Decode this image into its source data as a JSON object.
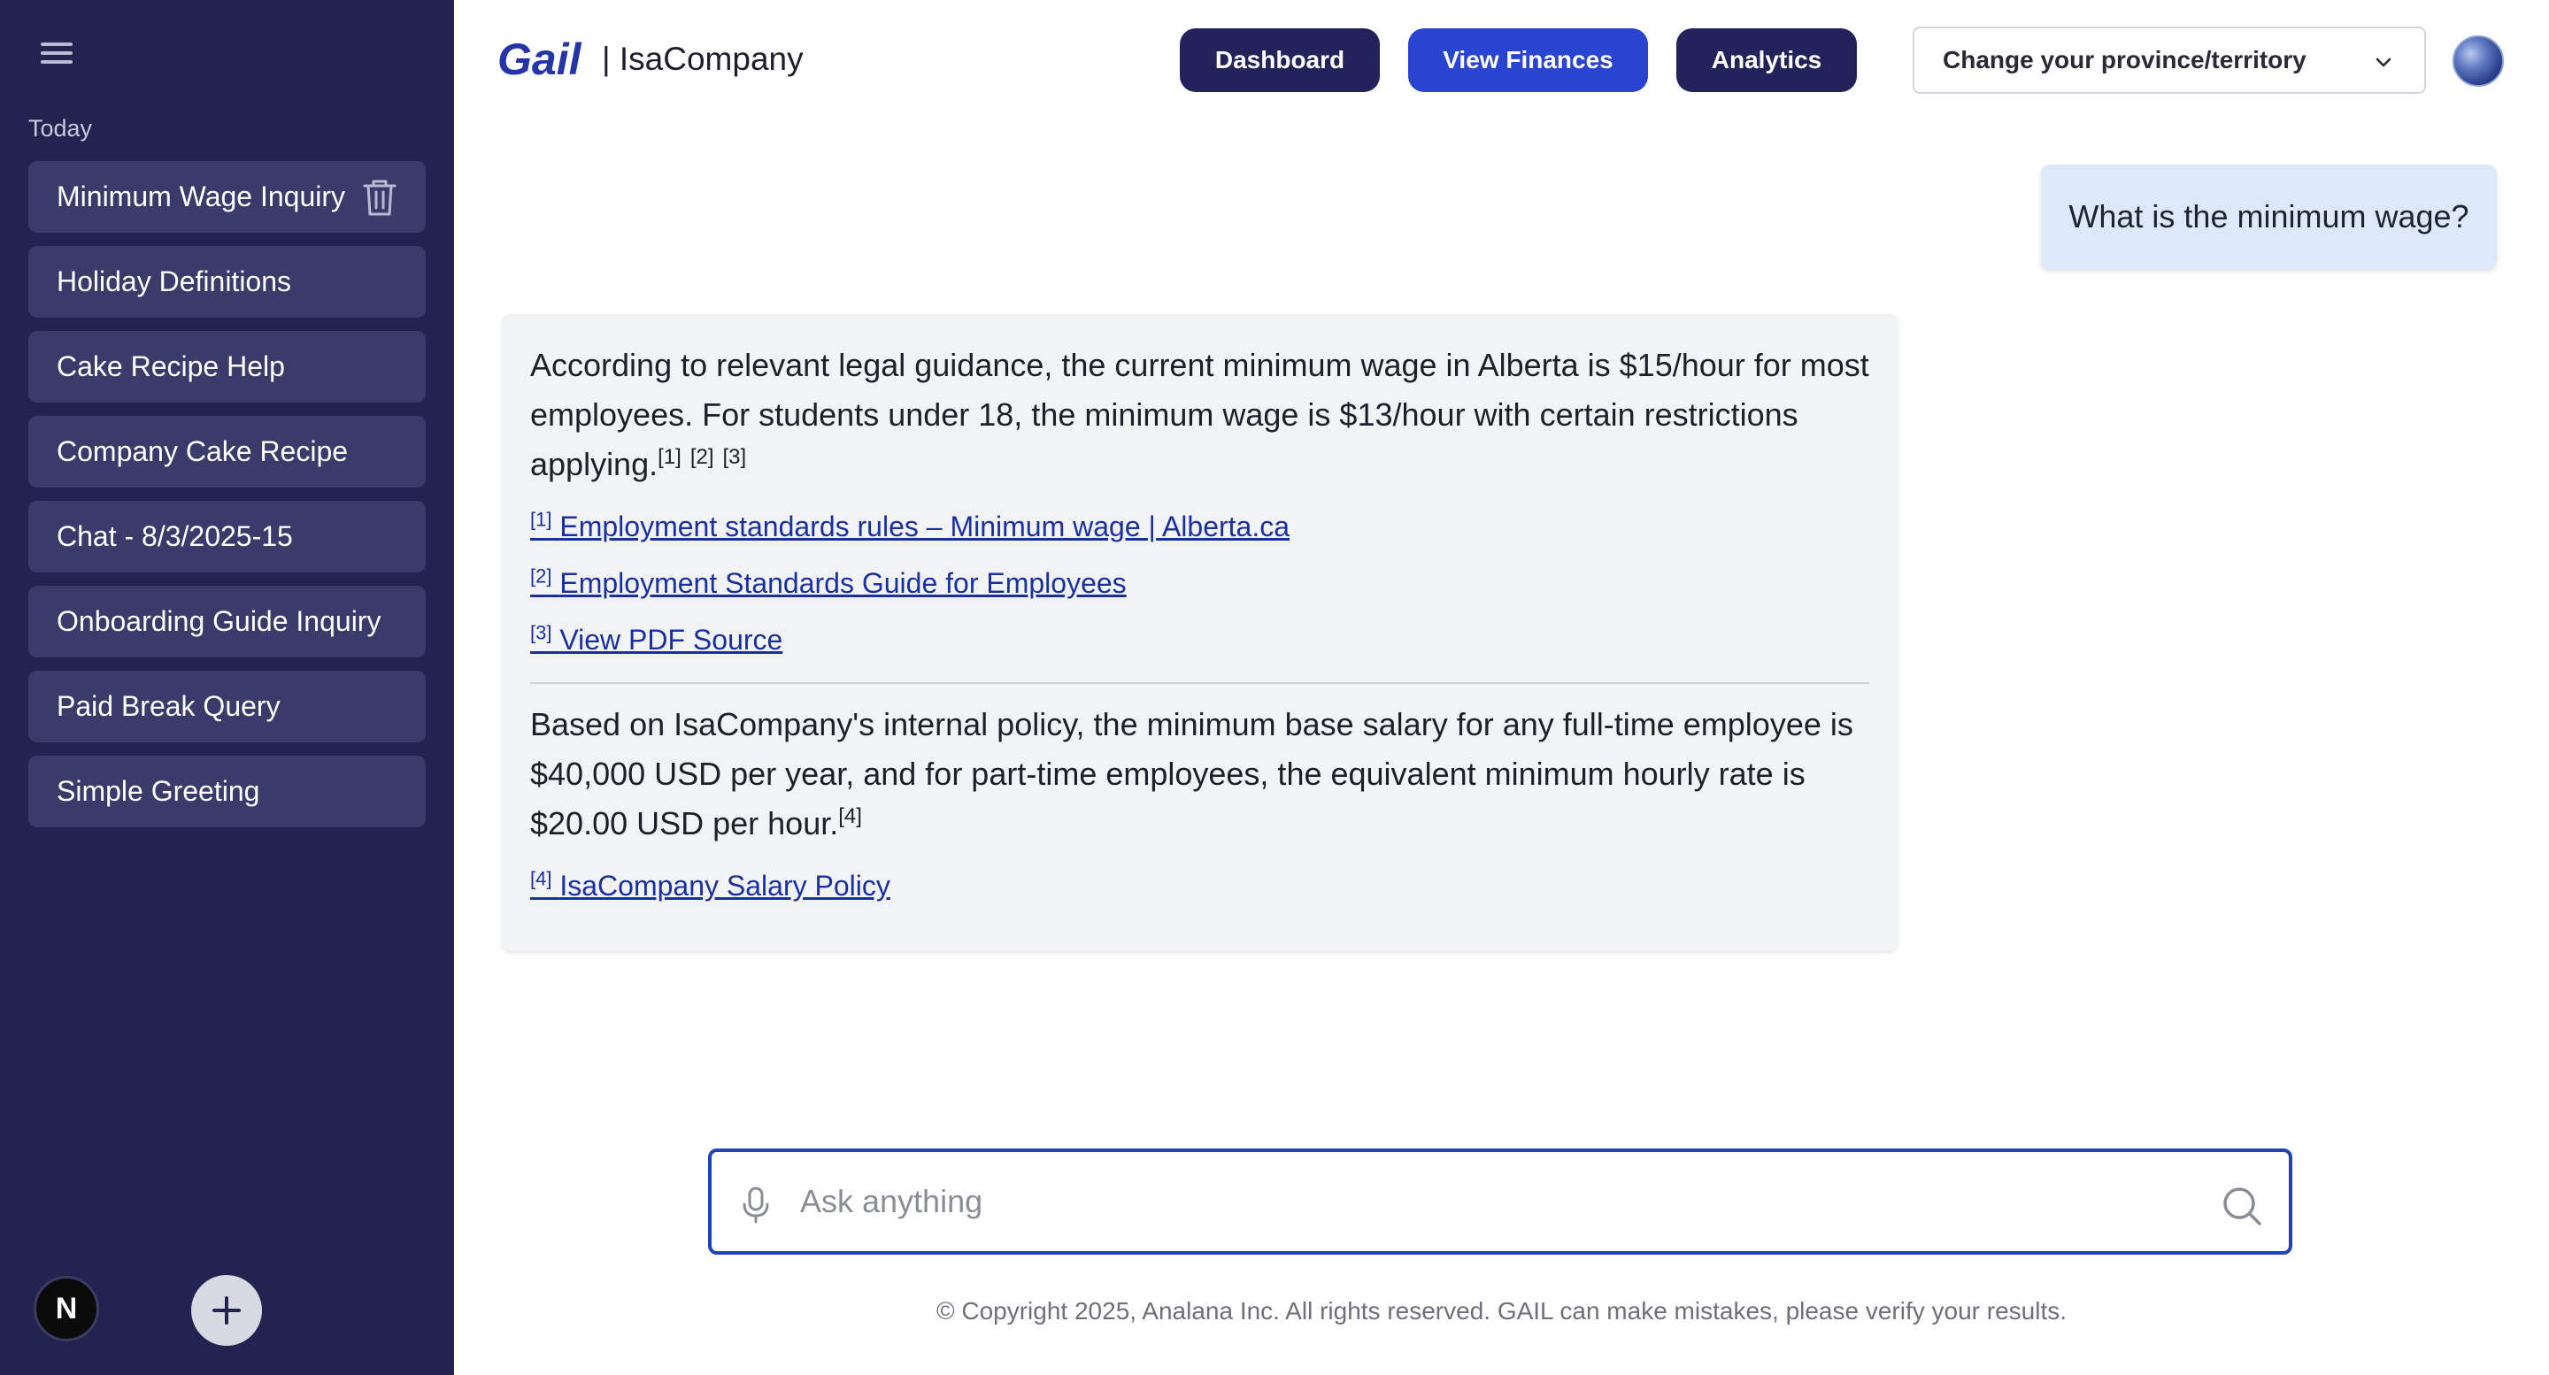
{
  "sidebar": {
    "section_label": "Today",
    "items": [
      {
        "label": "Minimum Wage Inquiry"
      },
      {
        "label": "Holiday Definitions"
      },
      {
        "label": "Cake Recipe Help"
      },
      {
        "label": "Company Cake Recipe"
      },
      {
        "label": "Chat - 8/3/2025-15"
      },
      {
        "label": "Onboarding Guide Inquiry"
      },
      {
        "label": "Paid Break Query"
      },
      {
        "label": "Simple Greeting"
      }
    ],
    "user_initial": "N",
    "icons": [
      "menu-icon",
      "trash-icon",
      "plus-icon"
    ]
  },
  "header": {
    "brand": "Gail",
    "company": "| IsaCompany",
    "nav": {
      "dashboard": "Dashboard",
      "finances": "View Finances",
      "analytics": "Analytics"
    },
    "province_select": "Change your province/territory"
  },
  "conversation": {
    "user_message": "What is the minimum wage?",
    "answer_1": {
      "text": "According to relevant legal guidance, the current minimum wage in Alberta is $15/hour for most employees. For students under 18, the minimum wage is $13/hour with certain restrictions applying.",
      "citations": [
        "[1]",
        "[2]",
        "[3]"
      ],
      "references": [
        {
          "marker": "[1]",
          "label": "Employment standards rules – Minimum wage | Alberta.ca"
        },
        {
          "marker": "[2]",
          "label": "Employment Standards Guide for Employees"
        },
        {
          "marker": "[3]",
          "label": "View PDF Source"
        }
      ]
    },
    "answer_2": {
      "text": "Based on IsaCompany's internal policy, the minimum base salary for any full-time employee is $40,000 USD per year, and for part-time employees, the equivalent minimum hourly rate is $20.00 USD per hour.",
      "citation": "[4]",
      "reference": {
        "marker": "[4]",
        "label": "IsaCompany Salary Policy"
      }
    }
  },
  "input": {
    "placeholder": "Ask anything",
    "value": ""
  },
  "footer": "© Copyright 2025, Analana Inc. All rights reserved. GAIL can make mistakes, please verify your results.",
  "colors": {
    "sidebar_bg": "#23234f",
    "sidebar_item_bg": "#3a3b6a",
    "primary_dark": "#23235c",
    "primary_accent": "#2844d0",
    "link": "#1a2fa0",
    "user_bubble": "#dde8f8",
    "bot_bubble": "#f2f3f5"
  }
}
